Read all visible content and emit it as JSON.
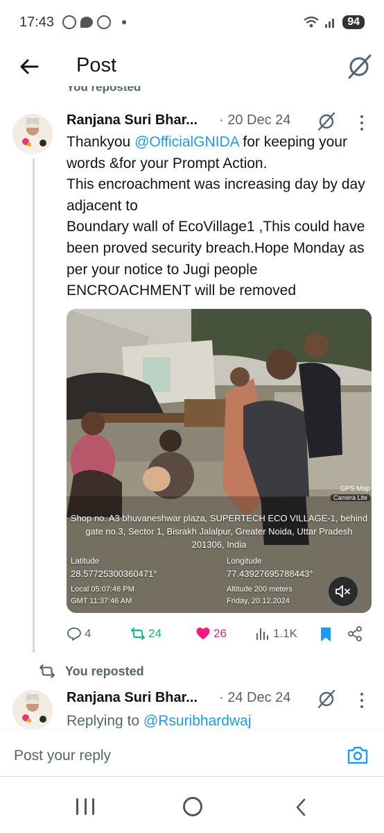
{
  "status_bar": {
    "time": "17:43",
    "battery": "94"
  },
  "header": {
    "title": "Post"
  },
  "repost_top": {
    "label": "You reposted"
  },
  "tweet": {
    "author_name": "Ranjana Suri Bhar...",
    "date": "· 20 Dec 24",
    "text_pre": "Thankyou ",
    "mention": "@OfficialGNIDA",
    "text_post": " for keeping your words &for your Prompt Action.",
    "line2": "This encroachment was increasing day by day adjacent to",
    "line3": "Boundary wall of EcoVillage1 ,This could have been proved security breach.Hope Monday as per your notice to Jugi people ENCROACHMENT will be removed",
    "media": {
      "gps_logo_line1": "GPS Map",
      "gps_logo_line2": "Camera Lite",
      "address": "Shop no. A3 bhuvaneshwar plaza, SUPERTECH ECO VILLAGE-1, behind gate no.3, Sector 1, Bisrakh Jalalpur, Greater Noida, Uttar Pradesh 201306, India",
      "latitude_label": "Latitude",
      "latitude_value": "28.57725300360471°",
      "longitude_label": "Longitude",
      "longitude_value": "77.43927695788443°",
      "local_time": "Local 05:07:46 PM",
      "gmt_time": "GMT 11:37:46 AM",
      "altitude": "Altitude 200 meters",
      "date": "Friday, 20.12.2024"
    },
    "stats": {
      "replies": "4",
      "reposts": "24",
      "likes": "26",
      "views": "1.1K"
    }
  },
  "repost_second": {
    "label": "You reposted"
  },
  "tweet2": {
    "author_name": "Ranjana Suri Bhar...",
    "date": "· 24 Dec 24",
    "replying_prefix": "Replying to ",
    "replying_handle": "@Rsuribhardwaj"
  },
  "reply_bar": {
    "placeholder": "Post your reply"
  },
  "colors": {
    "accent": "#1d9bf0",
    "repost_green": "#00ba7c",
    "like_pink": "#f91880",
    "text_secondary": "#536471"
  }
}
